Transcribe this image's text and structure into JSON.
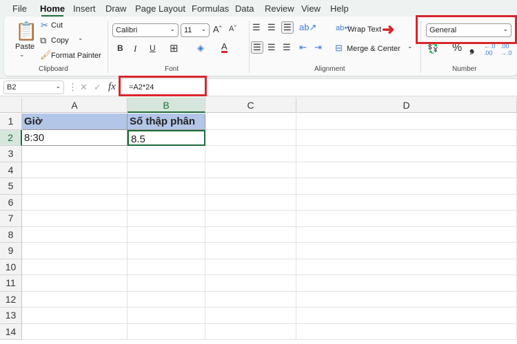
{
  "tabs": [
    "File",
    "Home",
    "Insert",
    "Draw",
    "Page Layout",
    "Formulas",
    "Data",
    "Review",
    "View",
    "Help"
  ],
  "clipboard": {
    "paste": "Paste",
    "cut": "Cut",
    "copy": "Copy",
    "format_painter": "Format Painter",
    "group": "Clipboard"
  },
  "font": {
    "name": "Calibri",
    "size": "11",
    "bold": "B",
    "italic": "I",
    "underline": "U",
    "group": "Font"
  },
  "alignment": {
    "wrap_text": "Wrap Text",
    "merge_center": "Merge & Center",
    "group": "Alignment"
  },
  "number": {
    "format": "General",
    "percent": "%",
    "comma": "❟",
    "group": "Number"
  },
  "formula_bar": {
    "name_box": "B2",
    "fx": "fx",
    "formula": "=A2*24"
  },
  "columns": [
    "A",
    "B",
    "C",
    "D"
  ],
  "rows": [
    "1",
    "2",
    "3",
    "4",
    "5",
    "6",
    "7",
    "8",
    "9",
    "10",
    "11",
    "12",
    "13",
    "14"
  ],
  "cells": {
    "A1": "Giờ",
    "B1": "Số thập phân",
    "A2": "8:30",
    "B2": "8.5"
  },
  "colors": {
    "accent": "#1e6b3a",
    "highlight": "#d9262b",
    "header_fill": "#b4c6e7"
  }
}
